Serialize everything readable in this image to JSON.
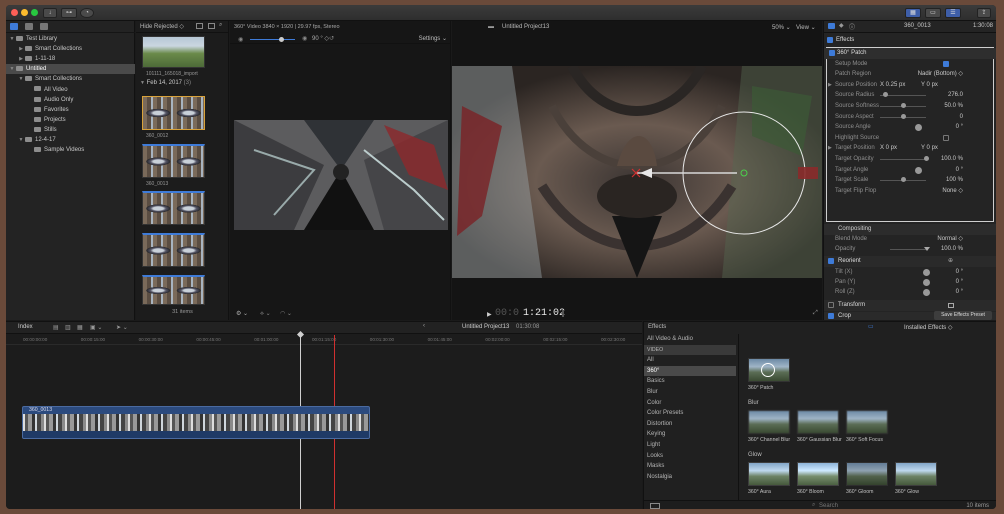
{
  "toolbar": {
    "save_effects_preset": "Save Effects Preset"
  },
  "library": {
    "items": [
      {
        "label": "Test Library",
        "level": 0,
        "arrow": "▼",
        "selected": false
      },
      {
        "label": "Smart Collections",
        "level": 1,
        "arrow": "▶",
        "selected": false
      },
      {
        "label": "1-11-18",
        "level": 1,
        "arrow": "▶",
        "selected": false
      },
      {
        "label": "Untitled",
        "level": 0,
        "arrow": "▼",
        "selected": true
      },
      {
        "label": "Smart Collections",
        "level": 1,
        "arrow": "▼",
        "selected": false
      },
      {
        "label": "All Video",
        "level": 2,
        "arrow": "",
        "selected": false
      },
      {
        "label": "Audio Only",
        "level": 2,
        "arrow": "",
        "selected": false
      },
      {
        "label": "Favorites",
        "level": 2,
        "arrow": "",
        "selected": false
      },
      {
        "label": "Projects",
        "level": 2,
        "arrow": "",
        "selected": false
      },
      {
        "label": "Stills",
        "level": 2,
        "arrow": "",
        "selected": false
      },
      {
        "label": "12-4-17",
        "level": 1,
        "arrow": "▼",
        "selected": false
      },
      {
        "label": "Sample Videos",
        "level": 2,
        "arrow": "",
        "selected": false
      }
    ]
  },
  "browser": {
    "filter": "Hide Rejected ◇",
    "top_clip_label": "101111_165018_import",
    "date_group": "Feb 14, 2017",
    "date_count": "(3)",
    "clip1_label": "360_0012",
    "clip2_label": "360_0013",
    "item_count": "31 items"
  },
  "viewer360": {
    "format": "360° Video 3840 × 1920 | 29.97 fps, Stereo",
    "angle": "90 ° ◇",
    "settings": "Settings ⌄"
  },
  "viewer": {
    "project": "Untitled Project13",
    "zoom": "50% ⌄",
    "view": "View ⌄",
    "timecode_dim": "00:0",
    "timecode": "1:21:02"
  },
  "inspector": {
    "clip": "360_0013",
    "duration": "1:30:08",
    "effects_header": "Effects",
    "rows": [
      {
        "label": "360° Patch",
        "value": "",
        "kind": "section"
      },
      {
        "label": "Setup Mode",
        "value": "",
        "kind": "check"
      },
      {
        "label": "Patch Region",
        "value": "Nadir (Bottom) ◇",
        "kind": "text"
      },
      {
        "label": "Source Position",
        "x": "X  0.25 px",
        "y": "Y  0 px",
        "kind": "xy"
      },
      {
        "label": "Source Radius",
        "value": "276.0",
        "kind": "slider",
        "level": 0.1
      },
      {
        "label": "Source Softness",
        "value": "50.0 %",
        "kind": "slider",
        "level": 0.5
      },
      {
        "label": "Source Aspect",
        "value": "0",
        "kind": "slider",
        "level": 0.5
      },
      {
        "label": "Source Angle",
        "value": "0 °",
        "kind": "dial"
      },
      {
        "label": "Highlight Source",
        "value": "",
        "kind": "checkoff"
      },
      {
        "label": "Target Position",
        "x": "X  0 px",
        "y": "Y  0 px",
        "kind": "xy"
      },
      {
        "label": "Target Opacity",
        "value": "100.0 %",
        "kind": "slider",
        "level": 1.0
      },
      {
        "label": "Target Angle",
        "value": "0 °",
        "kind": "dial"
      },
      {
        "label": "Target Scale",
        "value": "100 %",
        "kind": "slider",
        "level": 0.5
      },
      {
        "label": "Target Flip Flop",
        "value": "None ◇",
        "kind": "text"
      }
    ],
    "compositing": "Compositing",
    "blend_mode_label": "Blend Mode",
    "blend_mode_value": "Normal ◇",
    "opacity_label": "Opacity",
    "opacity_value": "100.0 %",
    "reorient": "Reorient",
    "tilt_label": "Tilt (X)",
    "pan_label": "Pan (Y)",
    "roll_label": "Roll (Z)",
    "tilt_value": "0 °",
    "pan_value": "0 °",
    "roll_value": "0 °",
    "transform": "Transform",
    "crop": "Crop"
  },
  "timeline": {
    "index": "Index",
    "project": "Untitled Project13",
    "duration": "01:30:08",
    "ruler": [
      "00:00:00:00",
      "00:00:15:00",
      "00:00:30:00",
      "00:00:45:00",
      "00:01:00:00",
      "00:01:15:00",
      "00:01:30:00",
      "00:01:45:00",
      "00:02:00:00",
      "00:02:15:00",
      "00:02:30:00"
    ],
    "clip_label": "360_0013"
  },
  "effects": {
    "title": "Effects",
    "installed": "Installed Effects ◇",
    "categories": [
      "All Video & Audio",
      "VIDEO",
      "All",
      "360°",
      "Basics",
      "Blur",
      "Color",
      "Color Presets",
      "Distortion",
      "Keying",
      "Light",
      "Looks",
      "Masks",
      "Nostalgia"
    ],
    "selected_category": "360°",
    "featured": "360° Patch",
    "blur_header": "Blur",
    "blur": [
      "360° Channel Blur",
      "360° Gaussian Blur",
      "360° Soft Focus"
    ],
    "glow_header": "Glow",
    "glow": [
      "360° Aura",
      "360° Bloom",
      "360° Gloom",
      "360° Glow"
    ],
    "search_placeholder": "Search",
    "count": "10 items"
  },
  "colors": {
    "accent": "#3e7bd8",
    "playhead": "#d03030",
    "clip": "#2b4a7e"
  }
}
